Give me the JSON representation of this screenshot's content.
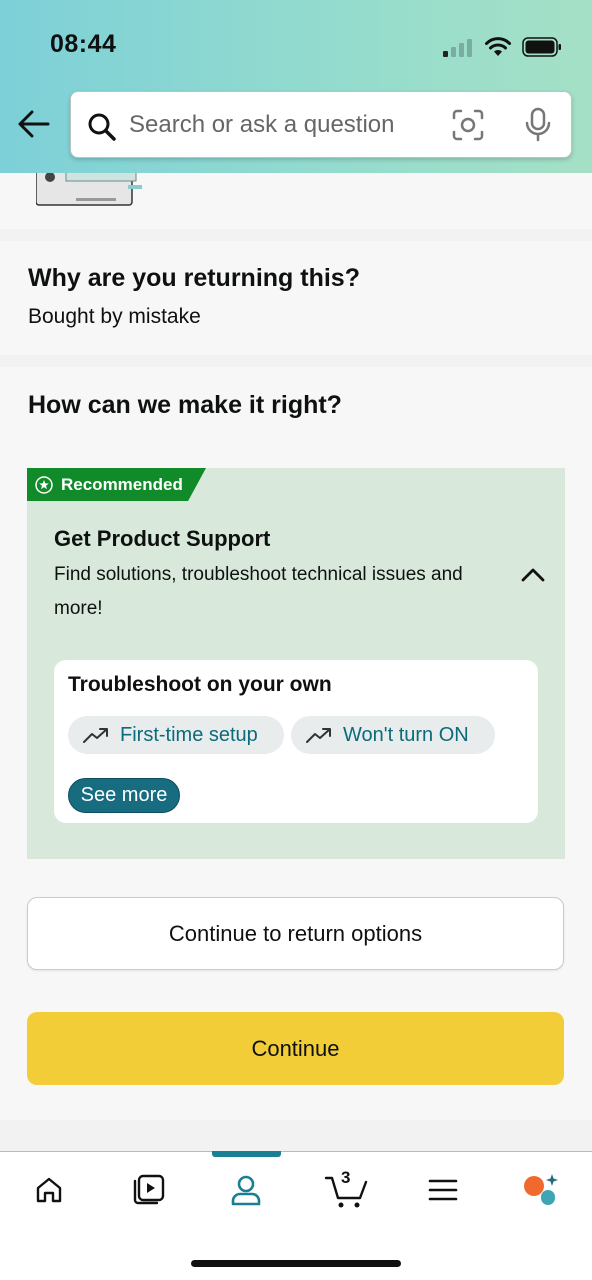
{
  "status_bar": {
    "time": "08:44"
  },
  "search": {
    "placeholder": "Search or ask a question"
  },
  "return_reason": {
    "title": "Why are you returning this?",
    "reason": "Bought by mistake"
  },
  "make_it_right": {
    "title": "How can we make it right?",
    "badge": "Recommended",
    "support_title": "Get Product Support",
    "support_desc": "Find solutions, troubleshoot technical issues and more!",
    "troubleshoot_title": "Troubleshoot on your own",
    "chips": [
      {
        "label": "First-time setup",
        "icon": "trending-up-icon"
      },
      {
        "label": "Won't turn ON",
        "icon": "trending-up-icon"
      }
    ],
    "see_more_label": "See more"
  },
  "actions": {
    "secondary_label": "Continue to return options",
    "primary_label": "Continue"
  },
  "bottom_nav": {
    "items": [
      "home-icon",
      "video-icon",
      "account-icon",
      "cart-icon",
      "menu-icon",
      "assistant-icon"
    ],
    "cart_count": "3",
    "active": "account-icon"
  },
  "colors": {
    "header_gradient_start": "#7dd0d8",
    "header_gradient_end": "#a5e0c6",
    "recommended_green": "#118a2a",
    "support_bg": "#d8e9dc",
    "link_teal": "#0b6b7b",
    "primary_yellow": "#f2cd37",
    "nav_active": "#1b7f93"
  }
}
